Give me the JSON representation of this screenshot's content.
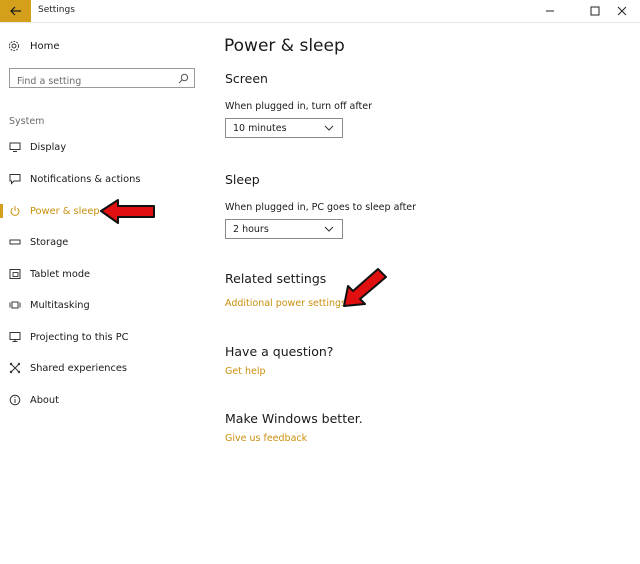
{
  "window": {
    "title": "Settings"
  },
  "sidebar": {
    "home_label": "Home",
    "search_placeholder": "Find a setting",
    "section_label": "System",
    "items": [
      {
        "label": "Display",
        "icon": "monitor-icon"
      },
      {
        "label": "Notifications & actions",
        "icon": "message-icon"
      },
      {
        "label": "Power & sleep",
        "icon": "power-icon",
        "active": true
      },
      {
        "label": "Storage",
        "icon": "storage-icon"
      },
      {
        "label": "Tablet mode",
        "icon": "tablet-icon"
      },
      {
        "label": "Multitasking",
        "icon": "multitasking-icon"
      },
      {
        "label": "Projecting to this PC",
        "icon": "projector-icon"
      },
      {
        "label": "Shared experiences",
        "icon": "share-icon"
      },
      {
        "label": "About",
        "icon": "info-icon"
      }
    ]
  },
  "main": {
    "title": "Power & sleep",
    "screen": {
      "heading": "Screen",
      "label": "When plugged in, turn off after",
      "value": "10 minutes"
    },
    "sleep": {
      "heading": "Sleep",
      "label": "When plugged in, PC goes to sleep after",
      "value": "2 hours"
    },
    "related": {
      "heading": "Related settings",
      "link": "Additional power settings"
    },
    "question": {
      "heading": "Have a question?",
      "link": "Get help"
    },
    "better": {
      "heading": "Make Windows better.",
      "link": "Give us feedback"
    }
  },
  "colors": {
    "accent": "#d4a01c",
    "link": "#c98f0c",
    "annotation": "#e01010"
  }
}
